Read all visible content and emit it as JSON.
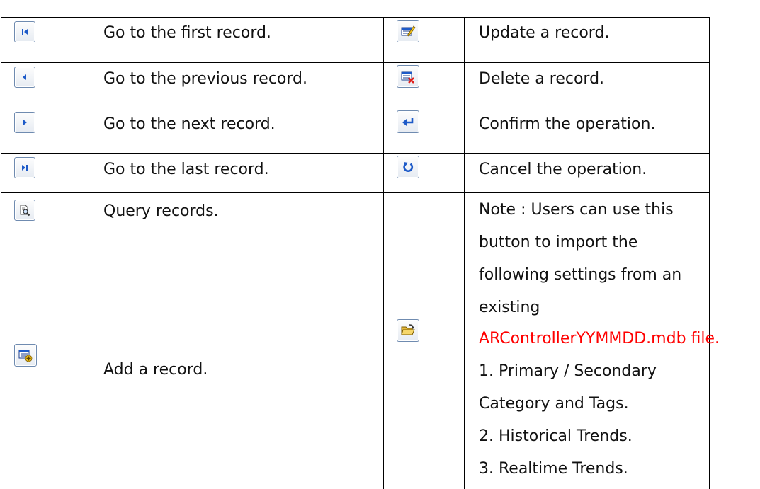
{
  "rows": [
    {
      "left_icon": "first-record-icon",
      "left_text": "Go to the first record.",
      "right_icon": "update-record-icon",
      "right_text": "Update a record."
    },
    {
      "left_icon": "previous-record-icon",
      "left_text": "Go to the previous record.",
      "right_icon": "delete-record-icon",
      "right_text": "Delete a record."
    },
    {
      "left_icon": "next-record-icon",
      "left_text": "Go to the next record.",
      "right_icon": "confirm-icon",
      "right_text": "Confirm the operation."
    },
    {
      "left_icon": "last-record-icon",
      "left_text": "Go to the last record.",
      "right_icon": "cancel-icon",
      "right_text": "Cancel the operation."
    },
    {
      "left_icon": "query-records-icon",
      "left_text": "Query records."
    },
    {
      "left_icon": "add-record-icon",
      "left_text": "Add a record."
    }
  ],
  "import": {
    "icon": "open-folder-icon",
    "note_lines": [
      "Note : Users can use this",
      "button to import the",
      "following settings from an",
      "existing"
    ],
    "file_name": "ARControllerYYMMDD.mdb file.",
    "list_lines": [
      "1. Primary / Secondary",
      "Category and Tags.",
      "2. Historical Trends.",
      "3. Realtime Trends."
    ]
  },
  "colors": {
    "file_name": "#ff0000",
    "border": "#000000",
    "icon_blue": "#1d5ac8"
  }
}
